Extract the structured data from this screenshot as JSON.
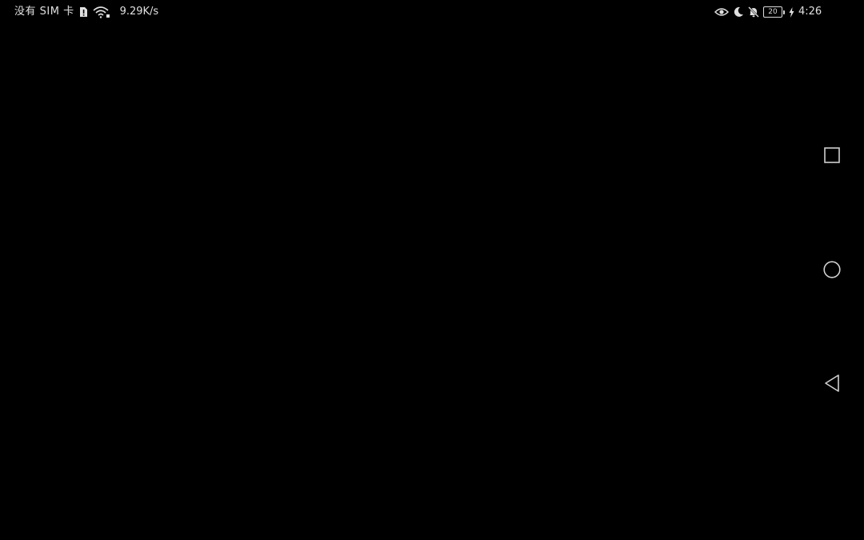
{
  "status_bar": {
    "carrier": "没有 SIM 卡",
    "network_speed": "9.29K/s",
    "time": "4:26",
    "battery_level": "20",
    "icons_left": [
      "sim-alert-icon",
      "wifi-icon"
    ],
    "icons_right": [
      "eye-comfort-icon",
      "do-not-disturb-moon-icon",
      "notifications-muted-icon",
      "battery-icon",
      "charging-bolt-icon"
    ]
  },
  "navigation_bar": {
    "buttons": [
      {
        "name": "recent-apps",
        "icon": "square-icon"
      },
      {
        "name": "home",
        "icon": "circle-icon"
      },
      {
        "name": "back",
        "icon": "triangle-back-icon"
      }
    ]
  },
  "colors": {
    "background": "#000000",
    "foreground": "#e0e0e0"
  }
}
